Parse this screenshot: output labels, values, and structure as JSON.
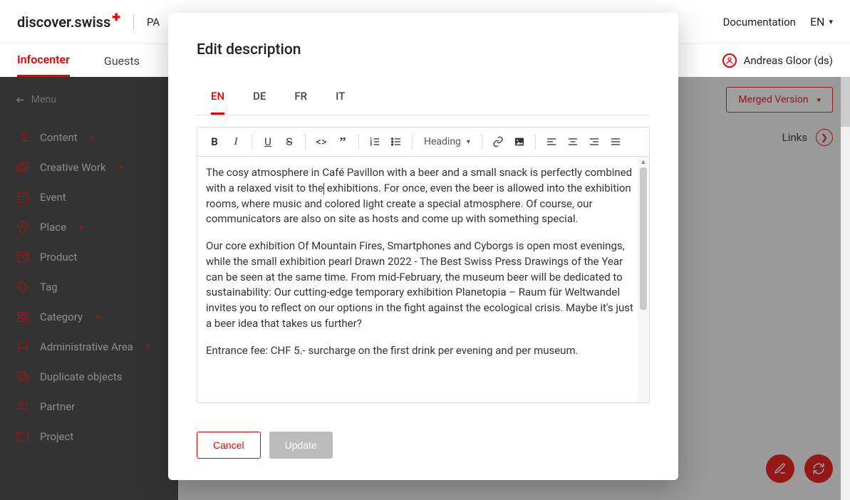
{
  "brand": {
    "name": "discover.swiss",
    "suffix_partner_initial": "PA"
  },
  "top": {
    "doc": "Documentation",
    "lang": "EN"
  },
  "nav": {
    "tabs": [
      "Infocenter",
      "Guests"
    ],
    "user": "Andreas Gloor (ds)"
  },
  "sidebar": {
    "menu": "Menu",
    "items": [
      {
        "label": "Content",
        "expandable": true
      },
      {
        "label": "Creative Work",
        "expandable": true
      },
      {
        "label": "Event",
        "expandable": false
      },
      {
        "label": "Place",
        "expandable": true
      },
      {
        "label": "Product",
        "expandable": false
      },
      {
        "label": "Tag",
        "expandable": false
      },
      {
        "label": "Category",
        "expandable": true
      },
      {
        "label": "Administrative Area",
        "expandable": true
      },
      {
        "label": "Duplicate objects",
        "expandable": false
      },
      {
        "label": "Partner",
        "expandable": false
      },
      {
        "label": "Project",
        "expandable": false
      }
    ]
  },
  "content": {
    "merged_btn": "Merged Version",
    "tab_links": "Links"
  },
  "modal": {
    "title": "Edit description",
    "lang_tabs": [
      "EN",
      "DE",
      "FR",
      "IT"
    ],
    "heading_label": "Heading",
    "editor": {
      "p1a": "The cosy atmosphere in Café Pavillon with a beer and a small snack is perfectly combined with a relaxed visit to the",
      "p1b": " exhibitions. For once, even the beer is allowed into the exhibition rooms, where music and colored light create a special atmosphere. Of course, our communicators are also on site as hosts and come up with something special.",
      "p2": "Our core exhibition Of Mountain Fires, Smartphones and Cyborgs is open most evenings, while the small exhibition pearl Drawn 2022 - The Best Swiss Press Drawings of the Year can be seen at the same time. From mid-February, the museum beer will be dedicated to sustainability: Our cutting-edge temporary exhibition Planetopia – Raum für Weltwandel invites you to reflect on our options in the fight against the ecological crisis. Maybe it's just a beer idea that takes us further?",
      "p3": "Entrance fee: CHF 5.- surcharge on the first drink per evening and per museum."
    },
    "cancel": "Cancel",
    "update": "Update"
  }
}
